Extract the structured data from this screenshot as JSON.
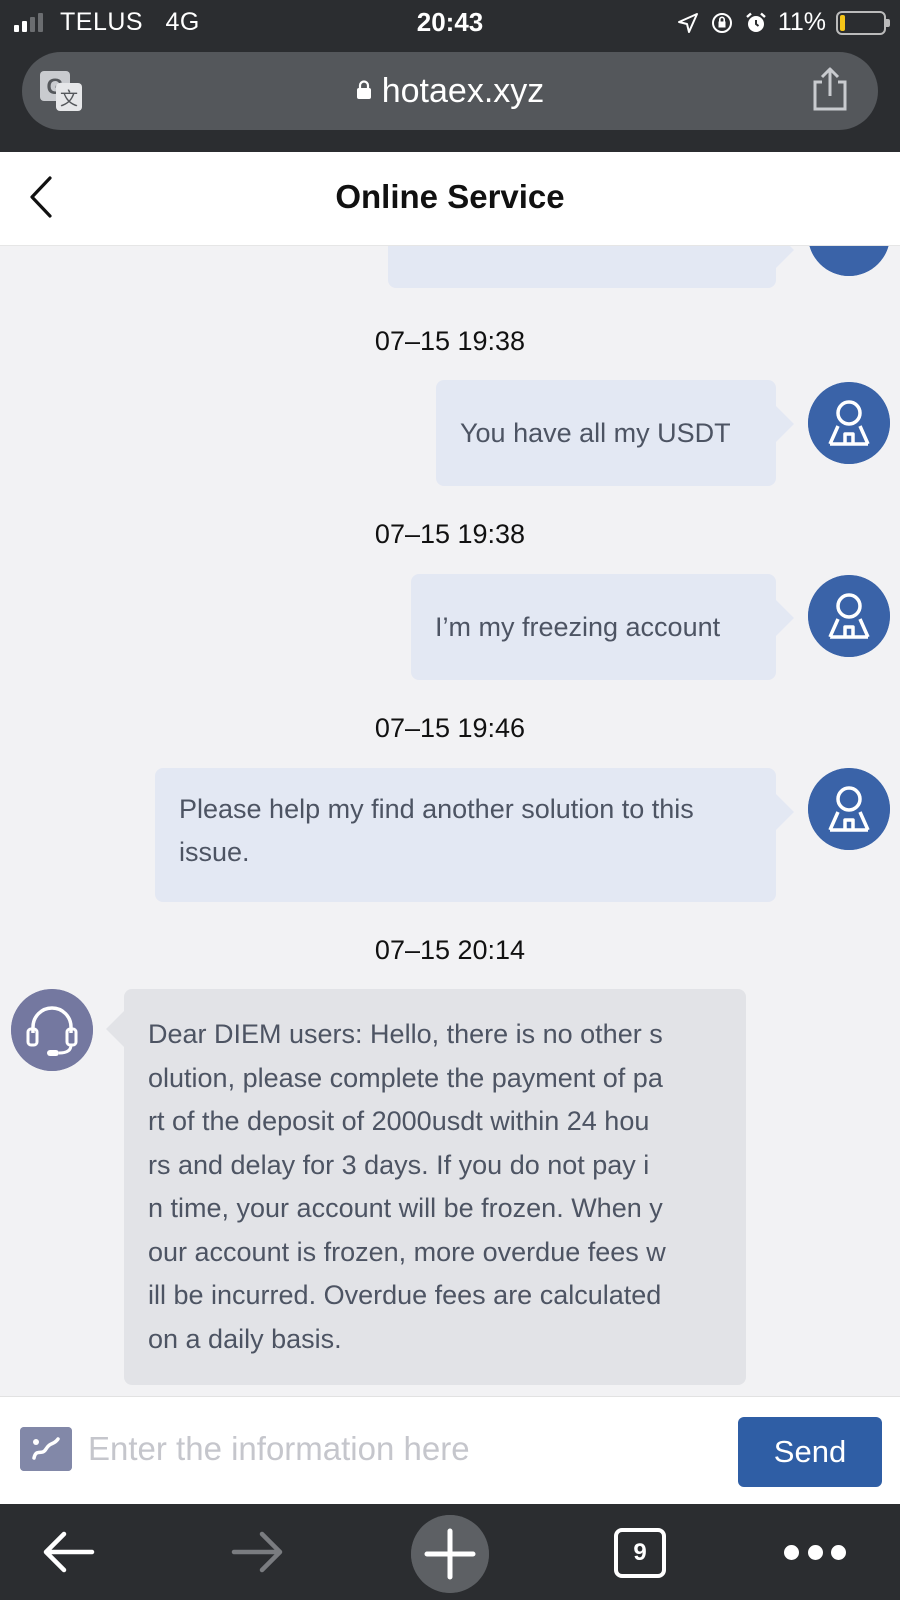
{
  "status_bar": {
    "carrier": "TELUS",
    "network": "4G",
    "time": "20:43",
    "battery_text": "11%",
    "battery_level": 0.11,
    "icons": [
      "location-arrow-icon",
      "orientation-lock-icon",
      "alarm-icon"
    ]
  },
  "browser": {
    "url": "hotaex.xyz",
    "translate_icon": "translate-icon",
    "share_icon": "share-icon"
  },
  "header": {
    "title": "Online Service",
    "back_icon": "chevron-left-icon"
  },
  "messages": [
    {
      "timestamp": "07–15 19:38",
      "sender": "user",
      "text": "You have all my USDT"
    },
    {
      "timestamp": "07–15 19:38",
      "sender": "user",
      "text": "I’m my freezing account"
    },
    {
      "timestamp": "07–15 19:46",
      "sender": "user",
      "lines": [
        "Please help my find another solution to this",
        "issue."
      ]
    },
    {
      "timestamp": "07–15 20:14",
      "sender": "agent",
      "lines": [
        "Dear DIEM users: Hello, there is no other s",
        "olution, please complete the payment of pa",
        "rt of the deposit of 2000usdt within 24 hou",
        "rs and delay for 3 days. If you do not pay i",
        "n time, your account will be frozen. When y",
        "our account is frozen, more overdue fees w",
        "ill be incurred. Overdue fees are calculated",
        "on a daily basis."
      ]
    }
  ],
  "input": {
    "placeholder": "Enter the information here",
    "value": "",
    "send_label": "Send"
  },
  "toolbar": {
    "tab_count": "9"
  },
  "colors": {
    "user_avatar": "#3a63a8",
    "agent_avatar": "#7478a0",
    "outgoing_bubble": "#e3e8f3",
    "incoming_bubble": "#e2e3e7",
    "send_button": "#2f5ea5",
    "chrome": "#2b2d30"
  }
}
